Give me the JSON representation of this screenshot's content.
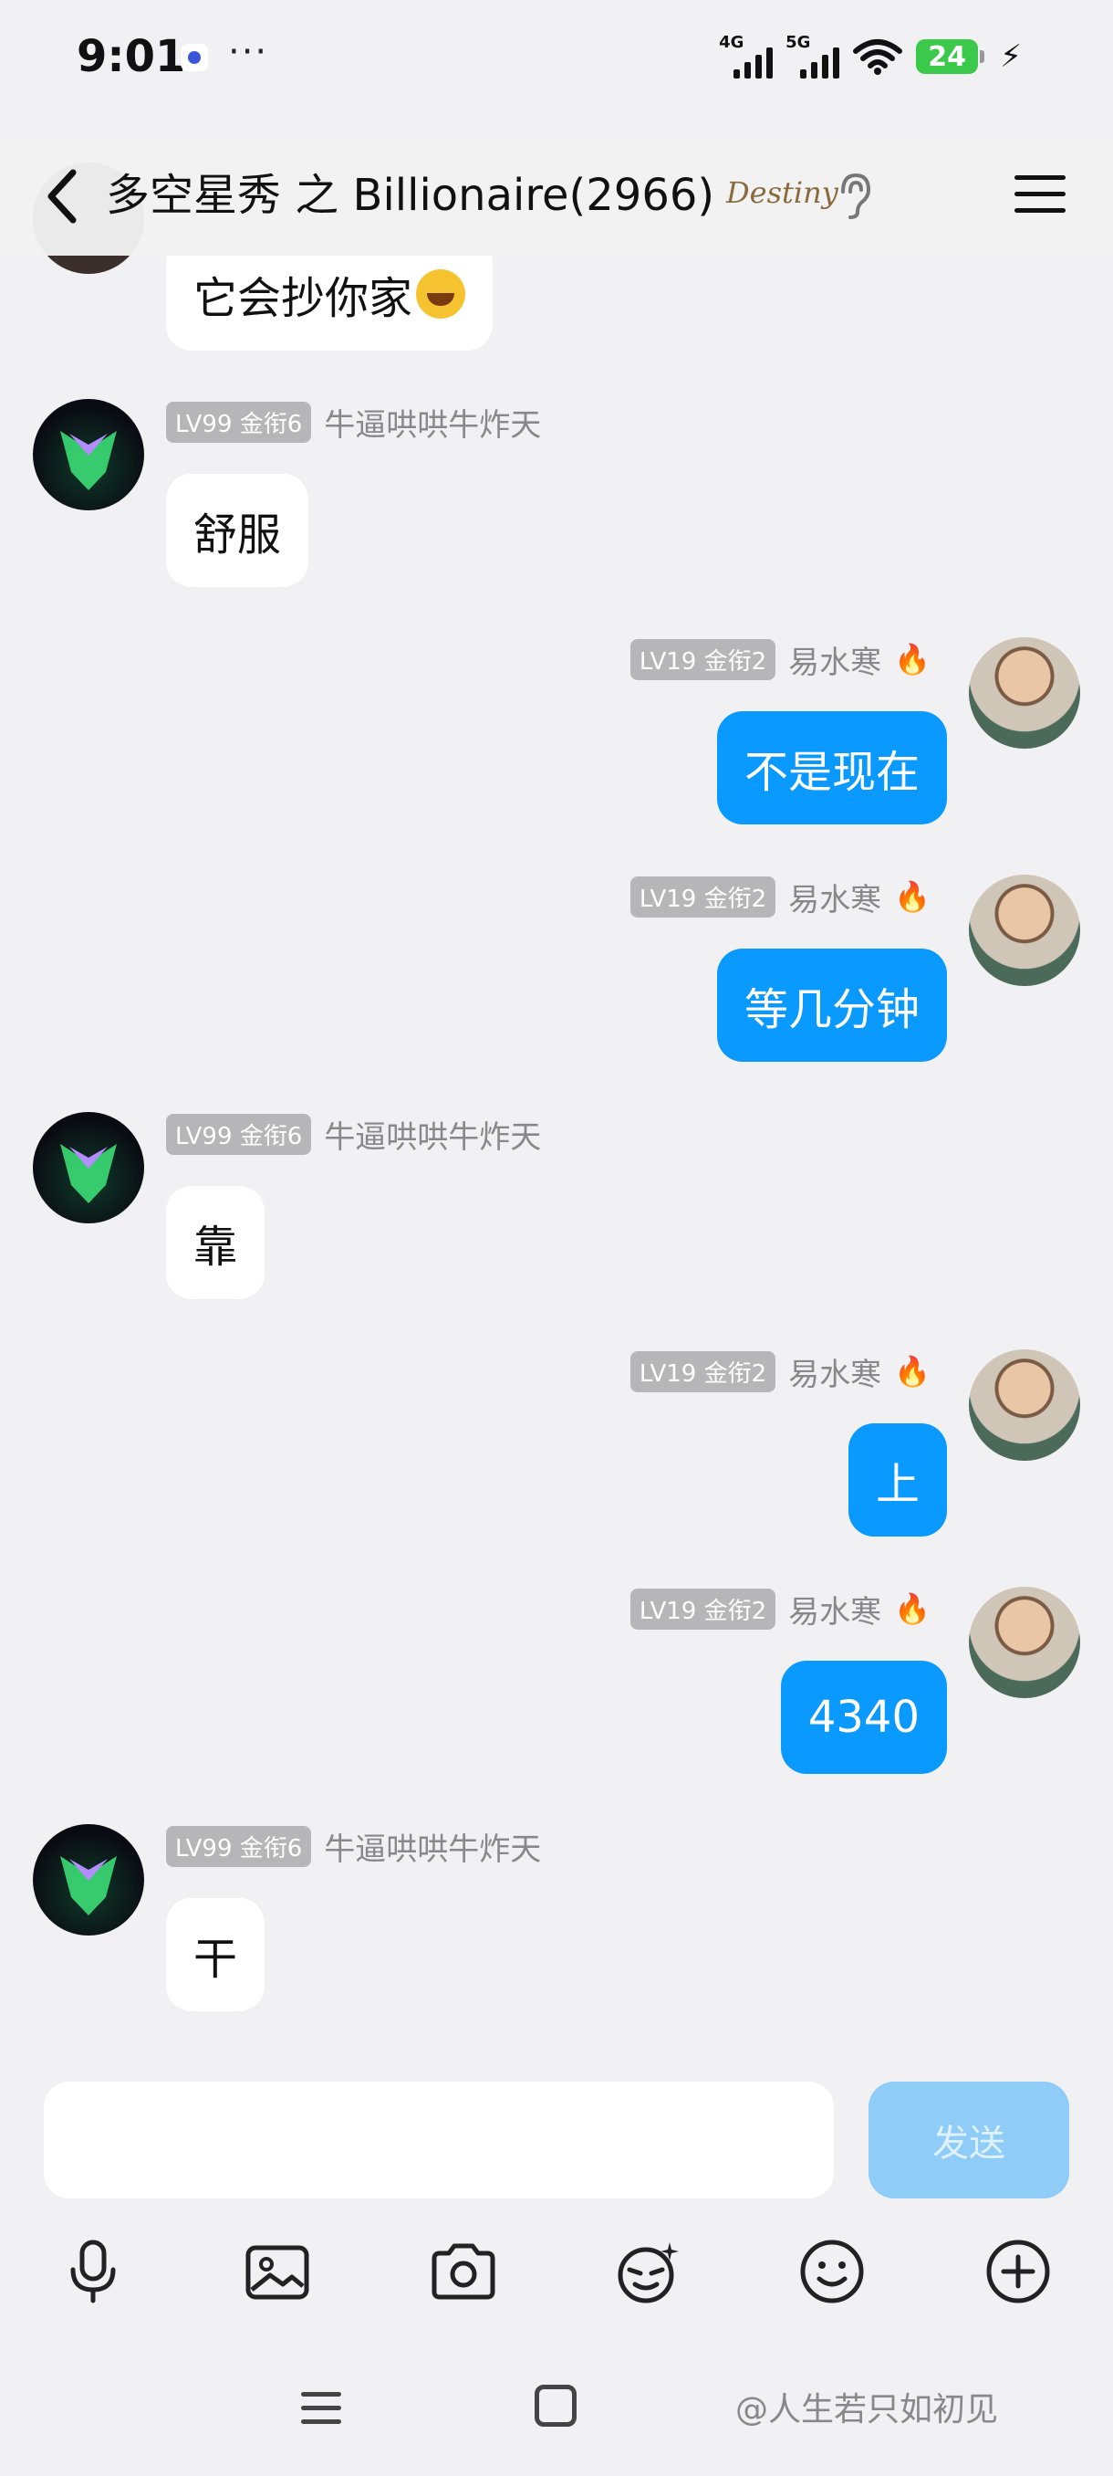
{
  "status_bar": {
    "time": "9:01",
    "more": "···",
    "net1": "4G",
    "net2": "5G",
    "battery": "24"
  },
  "header": {
    "title": "多空星秀 之 Billionaire(2966)",
    "badge_text": "Destiny"
  },
  "messages": [
    {
      "side": "left",
      "text": "它会抄你家",
      "has_emoji": true
    },
    {
      "side": "left",
      "level": "LV99 金衔6",
      "nick": "牛逼哄哄牛炸天",
      "text": "舒服"
    },
    {
      "side": "right",
      "level": "LV19 金衔2",
      "nick": "易水寒",
      "text": "不是现在"
    },
    {
      "side": "right",
      "level": "LV19 金衔2",
      "nick": "易水寒",
      "text": "等几分钟"
    },
    {
      "side": "left",
      "level": "LV99 金衔6",
      "nick": "牛逼哄哄牛炸天",
      "text": "靠"
    },
    {
      "side": "right",
      "level": "LV19 金衔2",
      "nick": "易水寒",
      "text": "上"
    },
    {
      "side": "right",
      "level": "LV19 金衔2",
      "nick": "易水寒",
      "text": "4340"
    },
    {
      "side": "left",
      "level": "LV99 金衔6",
      "nick": "牛逼哄哄牛炸天",
      "text": "干"
    }
  ],
  "input": {
    "placeholder": "",
    "send_label": "发送"
  },
  "toolbar": {
    "icons": [
      "microphone-icon",
      "image-icon",
      "camera-icon",
      "emoji-sticker-icon",
      "smiley-icon",
      "plus-icon"
    ]
  },
  "watermark": "@人生若只如初见"
}
